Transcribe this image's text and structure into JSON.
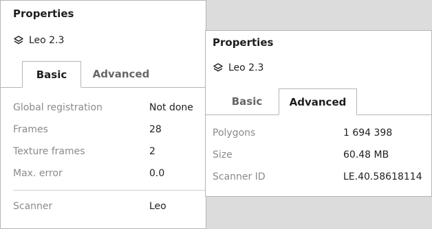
{
  "left_panel": {
    "title": "Properties",
    "model_name": "Leo 2.3",
    "tabs": [
      {
        "label": "Basic",
        "active": true
      },
      {
        "label": "Advanced",
        "active": false
      }
    ],
    "rows": [
      {
        "label": "Global registration",
        "value": "Not done"
      },
      {
        "label": "Frames",
        "value": "28"
      },
      {
        "label": "Texture frames",
        "value": "2"
      },
      {
        "label": "Max. error",
        "value": "0.0"
      }
    ],
    "scanner": {
      "label": "Scanner",
      "value": "Leo"
    }
  },
  "right_panel": {
    "title": "Properties",
    "model_name": "Leo 2.3",
    "tabs": [
      {
        "label": "Basic",
        "active": false
      },
      {
        "label": "Advanced",
        "active": true
      }
    ],
    "rows": [
      {
        "label": "Polygons",
        "value": "1 694 398"
      },
      {
        "label": "Size",
        "value": "60.48 MB"
      },
      {
        "label": "Scanner ID",
        "value": "LE.40.58618114"
      }
    ]
  },
  "icons": {
    "model": "layers-icon"
  },
  "colors": {
    "label": "#8a8a8a",
    "value": "#1e1e1e",
    "border": "#b5b5b5",
    "background": "#dcdcdc"
  }
}
